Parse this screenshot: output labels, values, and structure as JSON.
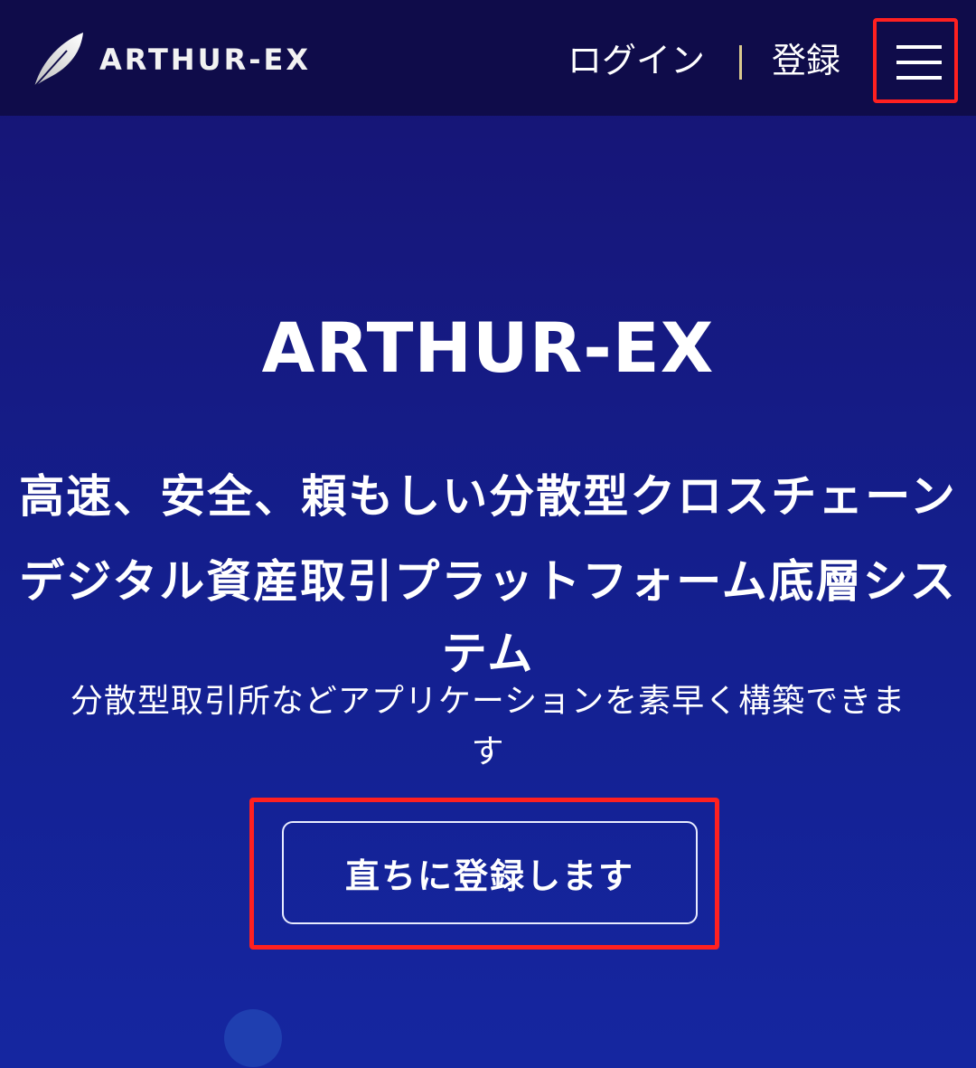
{
  "header": {
    "logo_text": "ARTHUR-EX",
    "login_label": "ログイン",
    "register_label": "登録",
    "menu_icon": "hamburger-icon"
  },
  "hero": {
    "title": "ARTHUR-EX",
    "heading_line1": "高速、安全、頼もしい分散型クロスチェーン",
    "heading_line2": "デジタル資産取引プラットフォーム底層シス",
    "heading_line3": "テム",
    "subheading_line1": "分散型取引所などアプリケーションを素早く構築できま",
    "subheading_line2": "す",
    "cta_label": "直ちに登録します"
  },
  "colors": {
    "header_bg": "#0f0c4a",
    "page_bg_top": "#171372",
    "page_bg_bottom": "#1526a0",
    "highlight_red": "#ff2020",
    "separator": "#d9c98e"
  }
}
